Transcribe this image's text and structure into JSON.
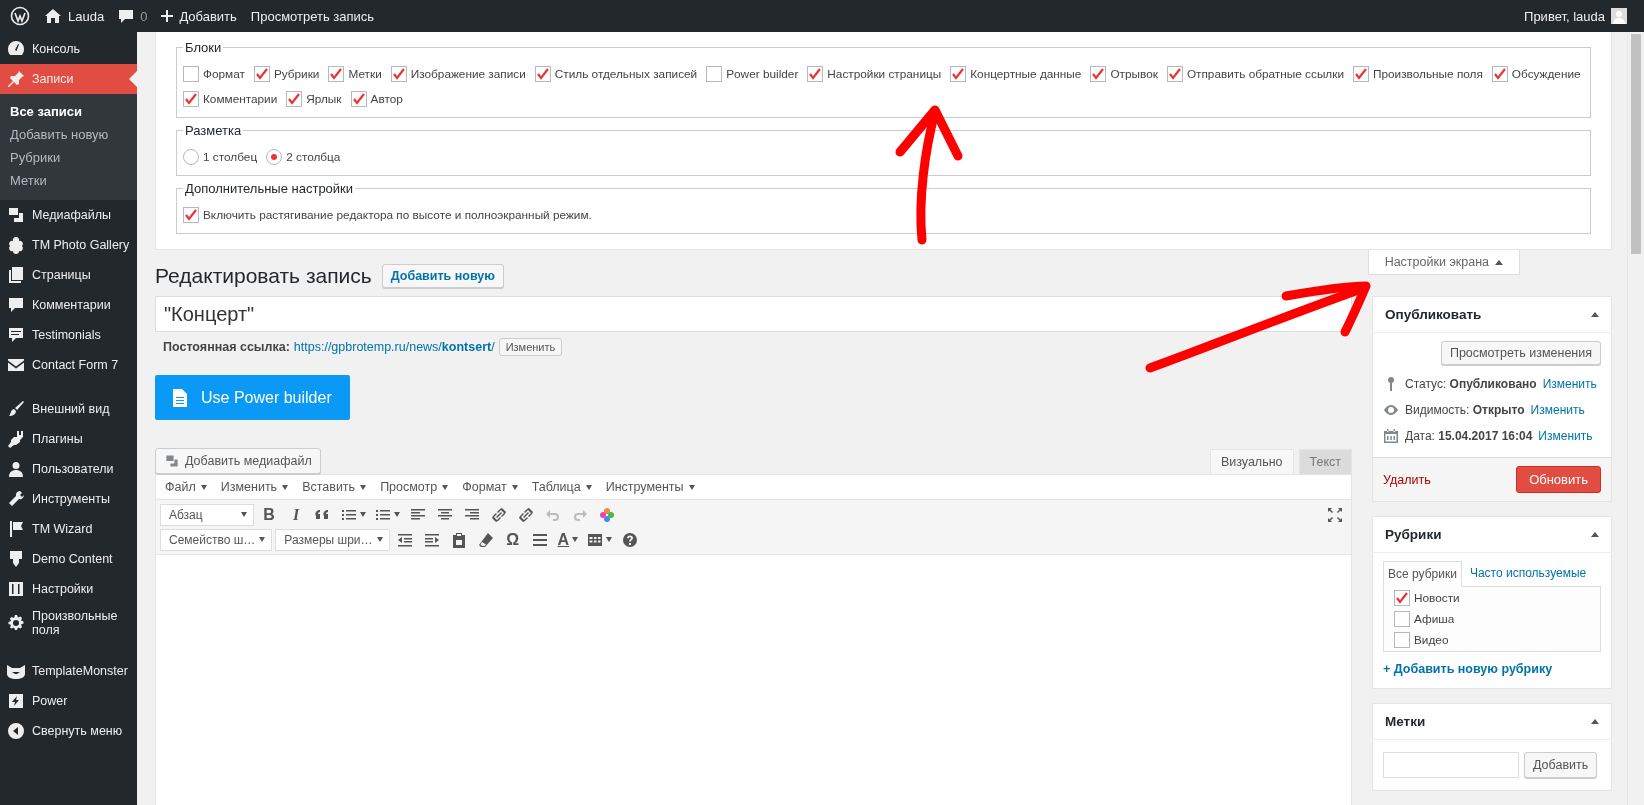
{
  "admin_bar": {
    "site": "Lauda",
    "comments": "0",
    "new": "Добавить",
    "view": "Просмотреть запись",
    "greeting": "Привет, lauda"
  },
  "menu": [
    [
      {
        "label": "Консоль",
        "selected": false
      },
      {
        "label": "Записи",
        "selected": true,
        "children": [
          {
            "label": "Все записи",
            "selected": true
          },
          {
            "label": "Добавить новую",
            "selected": false
          },
          {
            "label": "Рубрики",
            "selected": false
          },
          {
            "label": "Метки",
            "selected": false
          }
        ]
      },
      {
        "label": "Медиафайлы",
        "selected": false
      },
      {
        "label": "TM Photo Gallery",
        "selected": false
      },
      {
        "label": "Страницы",
        "selected": false
      },
      {
        "label": "Комментарии",
        "selected": false
      },
      {
        "label": "Testimonials",
        "selected": false
      },
      {
        "label": "Contact Form 7",
        "selected": false
      }
    ],
    [
      {
        "label": "Внешний вид",
        "selected": false
      },
      {
        "label": "Плагины",
        "selected": false
      },
      {
        "label": "Пользователи",
        "selected": false
      },
      {
        "label": "Инструменты",
        "selected": false
      },
      {
        "label": "TM Wizard",
        "selected": false
      },
      {
        "label": "Demo Content",
        "selected": false
      },
      {
        "label": "Настройки",
        "selected": false
      },
      {
        "label": "Произвольные поля",
        "selected": false
      }
    ],
    [
      {
        "label": "TemplateMonster",
        "selected": false
      },
      {
        "label": "Power",
        "selected": false
      },
      {
        "label": "Свернуть меню",
        "selected": false
      }
    ]
  ],
  "screen_options": {
    "blocks": {
      "legend": "Блоки",
      "items": [
        {
          "label": "Формат",
          "checked": false
        },
        {
          "label": "Рубрики",
          "checked": true
        },
        {
          "label": "Метки",
          "checked": true
        },
        {
          "label": "Изображение записи",
          "checked": true
        },
        {
          "label": "Стиль отдельных записей",
          "checked": true
        },
        {
          "label": "Power builder",
          "checked": false
        },
        {
          "label": "Настройки страницы",
          "checked": true
        },
        {
          "label": "Концертные данные",
          "checked": true
        },
        {
          "label": "Отрывок",
          "checked": true
        },
        {
          "label": "Отправить обратные ссылки",
          "checked": true
        },
        {
          "label": "Произвольные поля",
          "checked": true
        },
        {
          "label": "Обсуждение",
          "checked": true
        },
        {
          "label": "Комментарии",
          "checked": true
        },
        {
          "label": "Ярлык",
          "checked": true
        },
        {
          "label": "Автор",
          "checked": true
        }
      ]
    },
    "layout": {
      "legend": "Разметка",
      "options": [
        {
          "label": "1 столбец",
          "selected": false
        },
        {
          "label": "2 столбца",
          "selected": true
        }
      ]
    },
    "extra": {
      "legend": "Дополнительные настройки",
      "items": [
        {
          "label": "Включить растягивание редактора по высоте и полноэкранный режим.",
          "checked": true
        }
      ]
    },
    "toggle": "Настройки экрана"
  },
  "heading": "Редактировать запись",
  "add_new": "Добавить новую",
  "title": "\"Концерт\"",
  "permalink": {
    "label": "Постоянная ссылка:",
    "url": "https://gpbrotemp.ru/news/**kontsert**/",
    "button": "Изменить"
  },
  "builder_button": "Use Power builder",
  "add_media": "Добавить медиафайл",
  "editor_tabs": [
    {
      "label": "Визуально",
      "selected": true
    },
    {
      "label": "Текст",
      "selected": false
    }
  ],
  "menubar": [
    "Файл",
    "Изменить",
    "Вставить",
    "Просмотр",
    "Формат",
    "Таблица",
    "Инструменты"
  ],
  "toolbar": [
    [
      {
        "kind": "select",
        "label": "Абзац",
        "disabled": false
      },
      {
        "kind": "bold",
        "label": "B",
        "disabled": false
      },
      {
        "kind": "italic",
        "label": "I",
        "disabled": false
      },
      {
        "kind": "quote",
        "disabled": false
      },
      {
        "kind": "bullist",
        "disabled": false
      },
      {
        "kind": "numlist",
        "disabled": false
      },
      {
        "kind": "alignleft",
        "disabled": false
      },
      {
        "kind": "aligncenter",
        "disabled": false
      },
      {
        "kind": "alignright",
        "disabled": false
      },
      {
        "kind": "link",
        "disabled": false
      },
      {
        "kind": "unlink",
        "disabled": false
      },
      {
        "kind": "undo",
        "disabled": true
      },
      {
        "kind": "redo",
        "disabled": true
      },
      {
        "kind": "flower",
        "disabled": false
      },
      {
        "kind": "fullscreen",
        "disabled": false
      }
    ],
    [
      {
        "kind": "select",
        "label": "Семейство ш…",
        "disabled": false
      },
      {
        "kind": "select",
        "label": "Размеры шри…",
        "disabled": false
      },
      {
        "kind": "outdent",
        "disabled": false
      },
      {
        "kind": "indent",
        "disabled": false
      },
      {
        "kind": "paste",
        "disabled": false
      },
      {
        "kind": "eraser",
        "disabled": false
      },
      {
        "kind": "glyph",
        "label": "Ω",
        "disabled": false
      },
      {
        "kind": "hr",
        "disabled": false
      },
      {
        "kind": "textcolor",
        "label": "A",
        "disabled": false
      },
      {
        "kind": "table",
        "disabled": false
      },
      {
        "kind": "help",
        "disabled": false
      }
    ]
  ],
  "publish": {
    "title": "Опубликовать",
    "preview": "Просмотреть изменения",
    "rows": [
      {
        "text": "Статус: **Опубликовано**",
        "link": "Изменить"
      },
      {
        "text": "Видимость: **Открыто**",
        "link": "Изменить"
      },
      {
        "text": "Дата: **15.04.2017 16:04**",
        "link": "Изменить"
      }
    ],
    "delete": "Удалить",
    "update": "Обновить"
  },
  "categories": {
    "title": "Рубрики",
    "tabs": [
      {
        "label": "Все рубрики",
        "selected": true
      },
      {
        "label": "Часто используемые",
        "selected": false
      }
    ],
    "items": [
      {
        "label": "Новости",
        "checked": true
      },
      {
        "label": "Афиша",
        "checked": false
      },
      {
        "label": "Видео",
        "checked": false
      }
    ],
    "add": "+ Добавить новую рубрику"
  },
  "tags": {
    "title": "Метки",
    "button": "Добавить"
  }
}
